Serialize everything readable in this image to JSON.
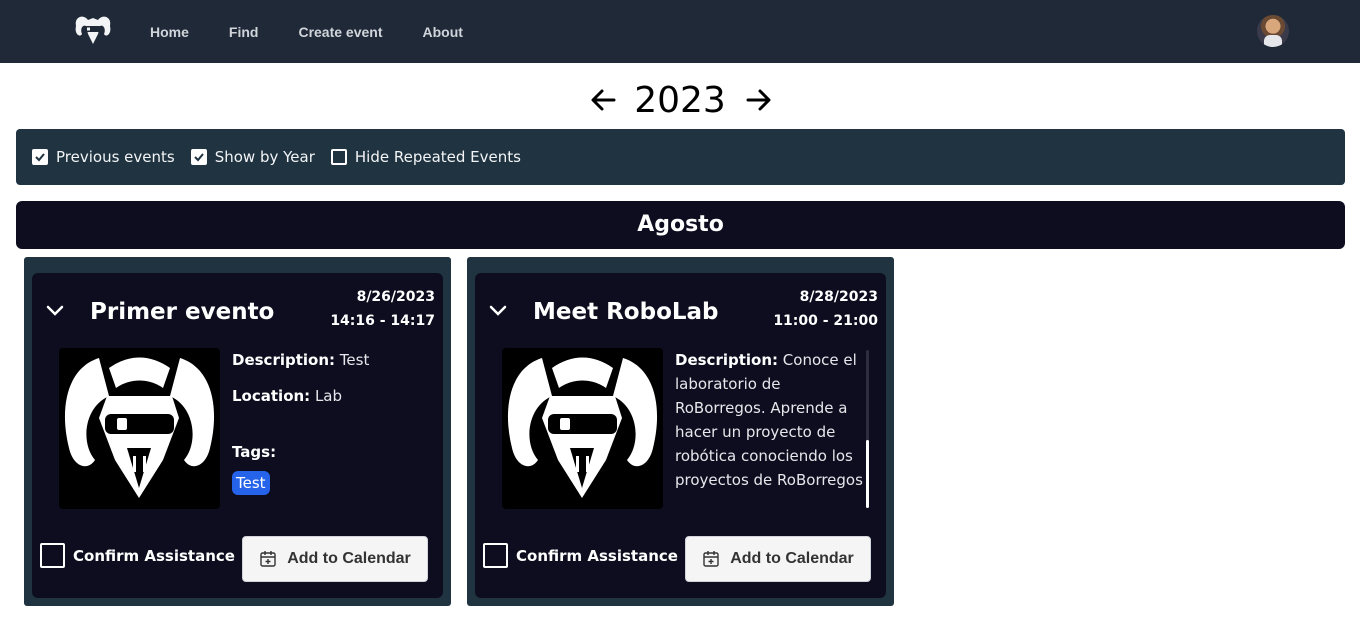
{
  "nav": {
    "logo_icon": "ram-logo-icon",
    "links": [
      {
        "label": "Home"
      },
      {
        "label": "Find"
      },
      {
        "label": "Create event"
      },
      {
        "label": "About"
      }
    ],
    "avatar_icon": "user-avatar"
  },
  "year_nav": {
    "year": "2023",
    "prev_icon": "arrow-left-icon",
    "next_icon": "arrow-right-icon"
  },
  "filters": [
    {
      "label": "Previous events",
      "checked": true
    },
    {
      "label": "Show by Year",
      "checked": true
    },
    {
      "label": "Hide Repeated Events",
      "checked": false
    }
  ],
  "month": "Agosto",
  "events": [
    {
      "title": "Primer evento",
      "date": "8/26/2023",
      "time": "14:16 - 14:17",
      "description_label": "Description:",
      "description": "Test",
      "location_label": "Location:",
      "location": "Lab",
      "tags_label": "Tags:",
      "tags": [
        "Test"
      ],
      "confirm_label": "Confirm Assistance",
      "add_calendar_label": "Add to Calendar"
    },
    {
      "title": "Meet RoboLab",
      "date": "8/28/2023",
      "time": "11:00 - 21:00",
      "description_label": "Description:",
      "description": "Conoce el laboratorio de RoBorregos. Aprende a hacer un proyecto de robótica conociendo los proyectos de RoBorregos",
      "confirm_label": "Confirm Assistance",
      "add_calendar_label": "Add to Calendar"
    }
  ],
  "colors": {
    "navbar": "#1f2937",
    "filter_bar": "#1f3340",
    "card": "#0e0d1f",
    "tag": "#2563eb"
  }
}
